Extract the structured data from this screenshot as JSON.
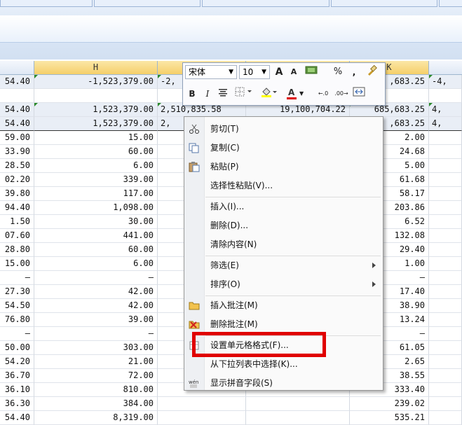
{
  "columns": {
    "h": "H",
    "k": "K"
  },
  "rows": [
    {
      "left": "54.40",
      "h": "-1,523,379.00",
      "i": "-2,",
      "j": "",
      "k": ",683.25",
      "l": "-4,",
      "tint": true
    },
    {
      "left": "",
      "h": "",
      "i": "",
      "j": "",
      "k": "",
      "l": ""
    },
    {
      "left": "54.40",
      "h": "1,523,379.00",
      "i": "2,510,835.58",
      "j": "19,100,704.22",
      "k": "685,683.25",
      "l": "4,",
      "tint": true
    },
    {
      "left": "54.40",
      "h": "1,523,379.00",
      "i": "2,",
      "j": "",
      "k": ",683.25",
      "l": "4,",
      "tint": true
    },
    {
      "left": "59.00",
      "h": "15.00",
      "k": "2.00"
    },
    {
      "left": "33.90",
      "h": "60.00",
      "k": "24.68"
    },
    {
      "left": "28.50",
      "h": "6.00",
      "k": "5.00"
    },
    {
      "left": "02.20",
      "h": "339.00",
      "k": "61.68"
    },
    {
      "left": "39.80",
      "h": "117.00",
      "k": "58.17"
    },
    {
      "left": "94.40",
      "h": "1,098.00",
      "k": "203.86"
    },
    {
      "left": "1.50",
      "h": "30.00",
      "k": "6.52"
    },
    {
      "left": "07.60",
      "h": "441.00",
      "k": "132.08"
    },
    {
      "left": "28.80",
      "h": "60.00",
      "k": "29.40"
    },
    {
      "left": "15.00",
      "h": "6.00",
      "k": "1.00"
    },
    {
      "left": "–",
      "h": "–",
      "k": "–"
    },
    {
      "left": "27.30",
      "h": "42.00",
      "k": "17.40"
    },
    {
      "left": "54.50",
      "h": "42.00",
      "k": "38.90"
    },
    {
      "left": "76.80",
      "h": "39.00",
      "k": "13.24"
    },
    {
      "left": "–",
      "h": "–",
      "k": "–"
    },
    {
      "left": "50.00",
      "h": "303.00",
      "k": "61.05"
    },
    {
      "left": "54.20",
      "h": "21.00",
      "k": "2.65"
    },
    {
      "left": "36.70",
      "h": "72.00",
      "k": "38.55"
    },
    {
      "left": "36.10",
      "h": "810.00",
      "k": "333.40"
    },
    {
      "left": "36.30",
      "h": "384.00",
      "k": "239.02"
    },
    {
      "left": "54.40",
      "h": "8,319.00",
      "k": "535.21"
    }
  ],
  "mini_toolbar": {
    "font": "宋体",
    "size": "10",
    "grow": "A",
    "shrink": "A",
    "percent": "%",
    "comma": ",",
    "bold": "B",
    "italic": "I",
    "dec_inc": "←.0",
    "dec_dec": ".00→",
    "font_color_letter": "A"
  },
  "menu": {
    "cut": "剪切(T)",
    "copy": "复制(C)",
    "paste": "粘贴(P)",
    "paste_special": "选择性粘贴(V)...",
    "insert": "插入(I)...",
    "delete": "删除(D)...",
    "clear": "清除内容(N)",
    "filter": "筛选(E)",
    "sort": "排序(O)",
    "insert_comment": "插入批注(M)",
    "delete_comment": "删除批注(M)",
    "format_cells": "设置单元格格式(F)...",
    "pick_list": "从下拉列表中选择(K)...",
    "phonetic": "显示拼音字段(S)"
  },
  "colors": {
    "highlight": "#e00000",
    "accent": "#2a8a2a"
  }
}
